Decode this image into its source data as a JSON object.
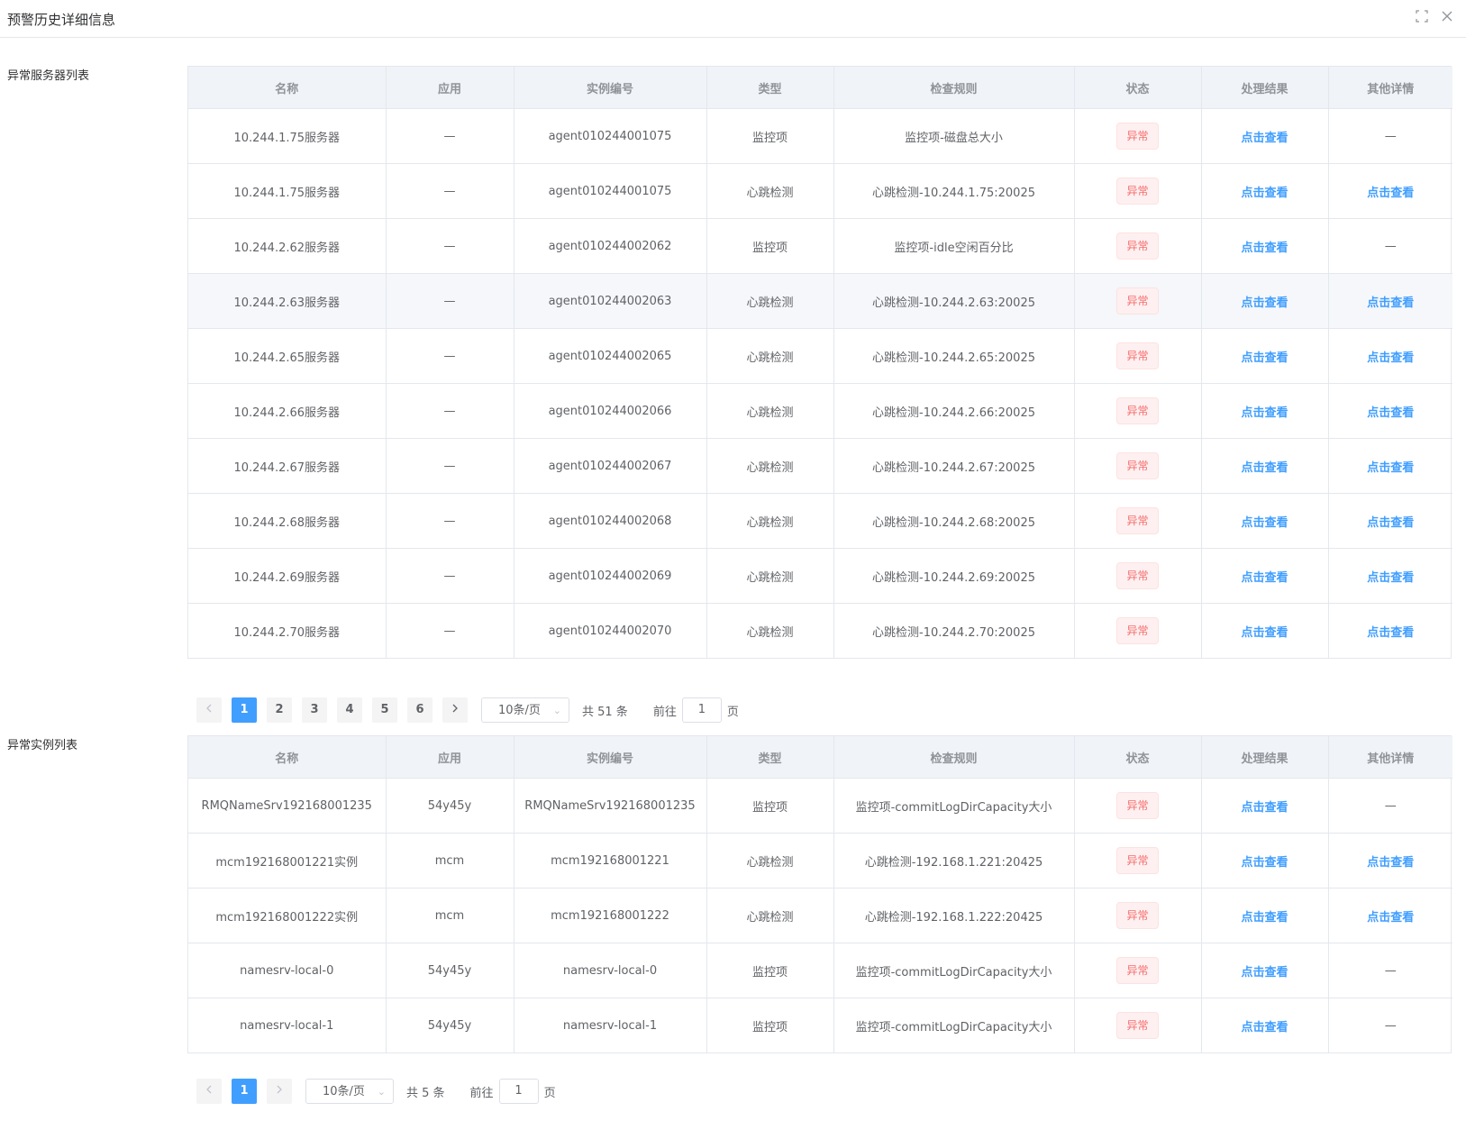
{
  "dialog": {
    "title": "预警历史详细信息"
  },
  "server_section": {
    "label": "异常服务器列表"
  },
  "instance_section": {
    "label": "异常实例列表"
  },
  "table_headers": [
    "名称",
    "应用",
    "实例编号",
    "类型",
    "检查规则",
    "状态",
    "处理结果",
    "其他详情"
  ],
  "server_rows": [
    {
      "name": "10.244.1.75服务器",
      "app": "—",
      "instance": "agent010244001075",
      "type": "监控项",
      "rule": "监控项-磁盘总大小",
      "status": "异常",
      "result": "点击查看",
      "detail": "—"
    },
    {
      "name": "10.244.1.75服务器",
      "app": "—",
      "instance": "agent010244001075",
      "type": "心跳检测",
      "rule": "心跳检测-10.244.1.75:20025",
      "status": "异常",
      "result": "点击查看",
      "detail": "点击查看"
    },
    {
      "name": "10.244.2.62服务器",
      "app": "—",
      "instance": "agent010244002062",
      "type": "监控项",
      "rule": "监控项-idle空闲百分比",
      "status": "异常",
      "result": "点击查看",
      "detail": "—"
    },
    {
      "name": "10.244.2.63服务器",
      "app": "—",
      "instance": "agent010244002063",
      "type": "心跳检测",
      "rule": "心跳检测-10.244.2.63:20025",
      "status": "异常",
      "result": "点击查看",
      "detail": "点击查看"
    },
    {
      "name": "10.244.2.65服务器",
      "app": "—",
      "instance": "agent010244002065",
      "type": "心跳检测",
      "rule": "心跳检测-10.244.2.65:20025",
      "status": "异常",
      "result": "点击查看",
      "detail": "点击查看"
    },
    {
      "name": "10.244.2.66服务器",
      "app": "—",
      "instance": "agent010244002066",
      "type": "心跳检测",
      "rule": "心跳检测-10.244.2.66:20025",
      "status": "异常",
      "result": "点击查看",
      "detail": "点击查看"
    },
    {
      "name": "10.244.2.67服务器",
      "app": "—",
      "instance": "agent010244002067",
      "type": "心跳检测",
      "rule": "心跳检测-10.244.2.67:20025",
      "status": "异常",
      "result": "点击查看",
      "detail": "点击查看"
    },
    {
      "name": "10.244.2.68服务器",
      "app": "—",
      "instance": "agent010244002068",
      "type": "心跳检测",
      "rule": "心跳检测-10.244.2.68:20025",
      "status": "异常",
      "result": "点击查看",
      "detail": "点击查看"
    },
    {
      "name": "10.244.2.69服务器",
      "app": "—",
      "instance": "agent010244002069",
      "type": "心跳检测",
      "rule": "心跳检测-10.244.2.69:20025",
      "status": "异常",
      "result": "点击查看",
      "detail": "点击查看"
    },
    {
      "name": "10.244.2.70服务器",
      "app": "—",
      "instance": "agent010244002070",
      "type": "心跳检测",
      "rule": "心跳检测-10.244.2.70:20025",
      "status": "异常",
      "result": "点击查看",
      "detail": "点击查看"
    }
  ],
  "instance_rows": [
    {
      "name": "RMQNameSrv192168001235",
      "app": "54y45y",
      "instance": "RMQNameSrv192168001235",
      "type": "监控项",
      "rule": "监控项-commitLogDirCapacity大小",
      "status": "异常",
      "result": "点击查看",
      "detail": "—"
    },
    {
      "name": "mcm192168001221实例",
      "app": "mcm",
      "instance": "mcm192168001221",
      "type": "心跳检测",
      "rule": "心跳检测-192.168.1.221:20425",
      "status": "异常",
      "result": "点击查看",
      "detail": "点击查看"
    },
    {
      "name": "mcm192168001222实例",
      "app": "mcm",
      "instance": "mcm192168001222",
      "type": "心跳检测",
      "rule": "心跳检测-192.168.1.222:20425",
      "status": "异常",
      "result": "点击查看",
      "detail": "点击查看"
    },
    {
      "name": "namesrv-local-0",
      "app": "54y45y",
      "instance": "namesrv-local-0",
      "type": "监控项",
      "rule": "监控项-commitLogDirCapacity大小",
      "status": "异常",
      "result": "点击查看",
      "detail": "—"
    },
    {
      "name": "namesrv-local-1",
      "app": "54y45y",
      "instance": "namesrv-local-1",
      "type": "监控项",
      "rule": "监控项-commitLogDirCapacity大小",
      "status": "异常",
      "result": "点击查看",
      "detail": "—"
    }
  ],
  "server_pager": {
    "pages": [
      "1",
      "2",
      "3",
      "4",
      "5",
      "6"
    ],
    "current": "1",
    "page_size": "10条/页",
    "total": "共 51 条",
    "goto_label": "前往",
    "goto_value": "1",
    "page_unit": "页"
  },
  "instance_pager": {
    "pages": [
      "1"
    ],
    "current": "1",
    "page_size": "10条/页",
    "total": "共 5 条",
    "goto_label": "前往",
    "goto_value": "1",
    "page_unit": "页"
  },
  "colors": {
    "accent": "#409eff",
    "danger": "#f56c6c",
    "header_bg": "#f0f3f7"
  }
}
